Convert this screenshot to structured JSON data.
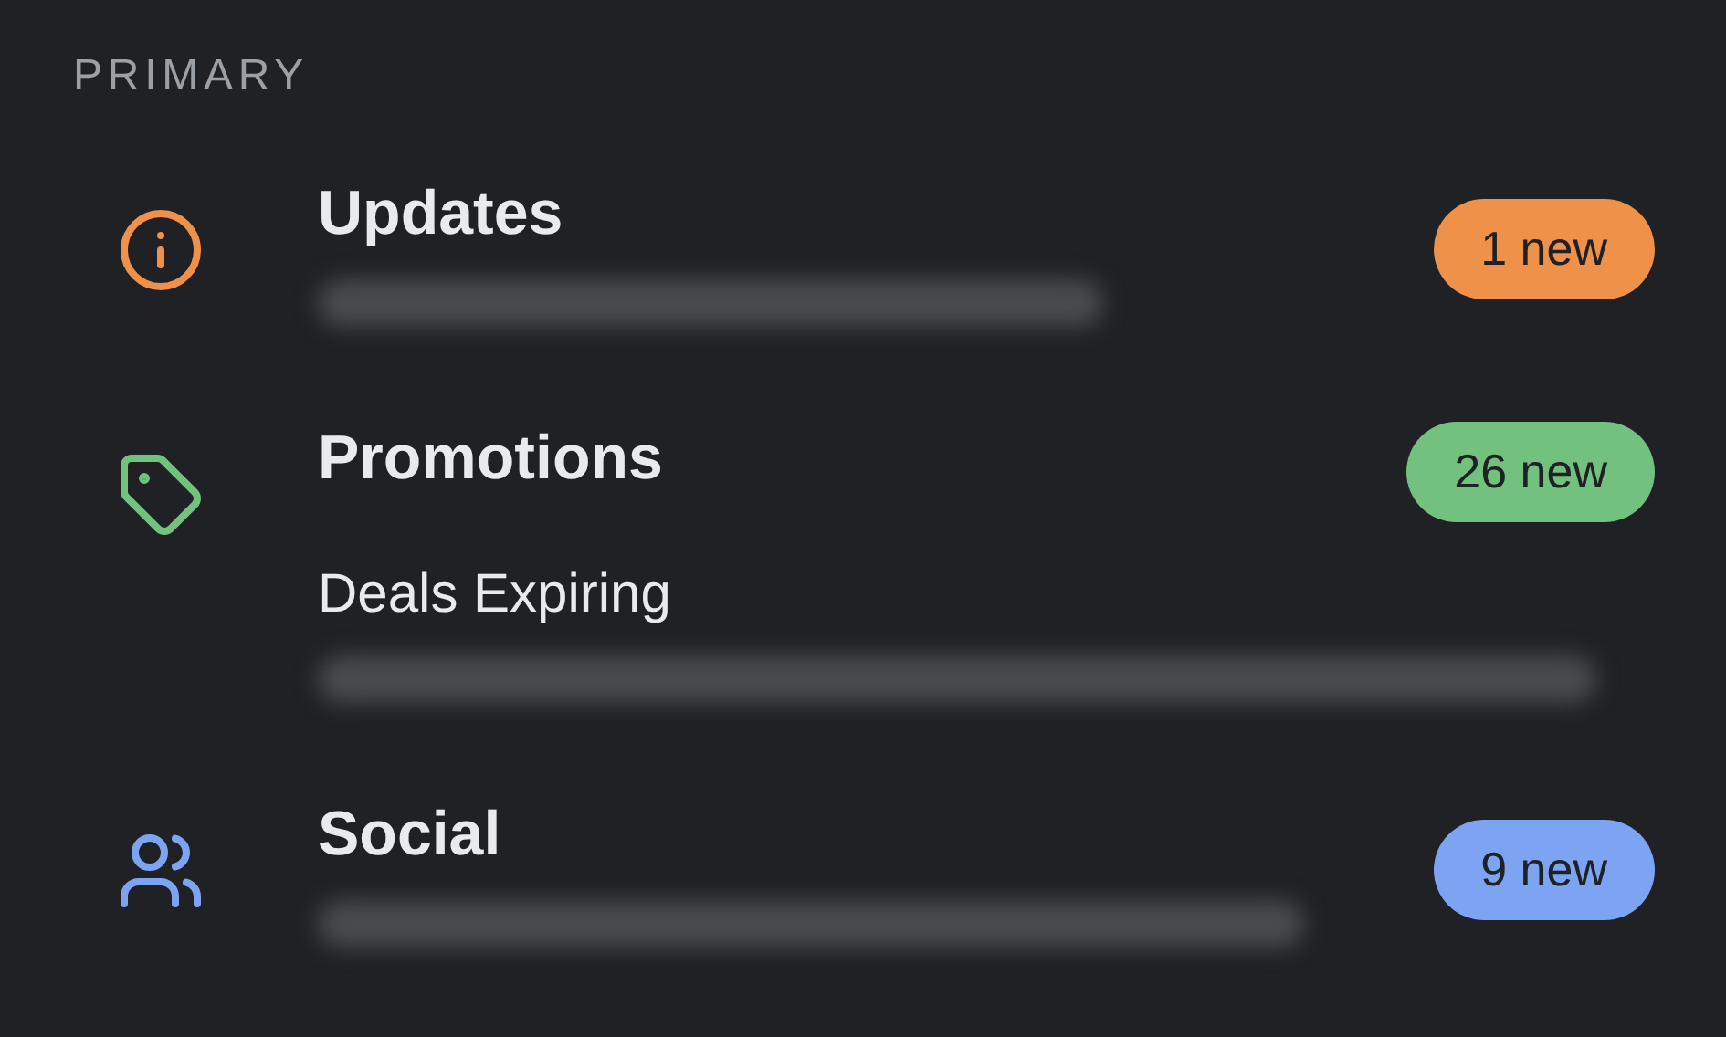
{
  "section_title": "PRIMARY",
  "categories": [
    {
      "title": "Updates",
      "badge": "1 new",
      "color": "#f0914a"
    },
    {
      "title": "Promotions",
      "subtitle": "Deals Expiring",
      "badge": "26 new",
      "color": "#72c17f"
    },
    {
      "title": "Social",
      "badge": "9 new",
      "color": "#7ca4f2"
    }
  ]
}
